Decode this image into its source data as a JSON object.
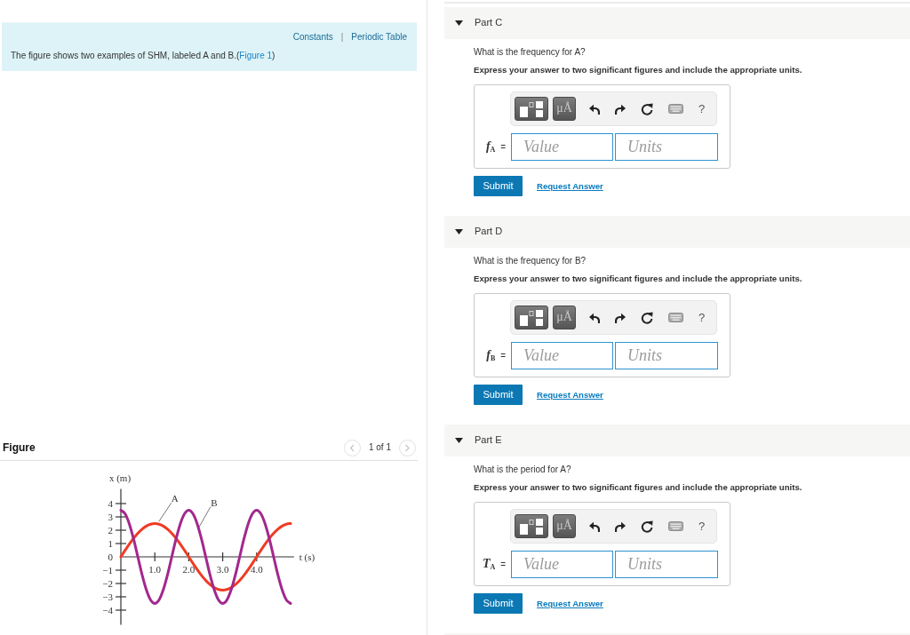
{
  "info": {
    "links": [
      "Constants",
      "Periodic Table"
    ],
    "separator": "|",
    "text": "The figure shows two examples of SHM, labeled A and B.(",
    "link": "Figure 1",
    "text_end": ")"
  },
  "figure": {
    "title": "Figure",
    "pager": {
      "prev_disabled": true,
      "label": "1 of 1",
      "next_disabled": true
    },
    "chart_data": {
      "type": "line",
      "xlabel": "t (s)",
      "ylabel": "x (m)",
      "x": [
        0,
        0.125,
        0.25,
        0.375,
        0.5,
        0.625,
        0.75,
        0.875,
        1,
        1.125,
        1.25,
        1.375,
        1.5,
        1.625,
        1.75,
        1.875,
        2,
        2.125,
        2.25,
        2.375,
        2.5,
        2.625,
        2.75,
        2.875,
        3,
        3.125,
        3.25,
        3.375,
        3.5,
        3.625,
        3.75,
        3.875,
        4,
        4.125,
        4.25,
        4.375,
        4.5,
        4.625,
        4.75,
        4.875,
        5
      ],
      "series": [
        {
          "name": "A",
          "color": "#ef3b24",
          "values": [
            0,
            0.49,
            0.96,
            1.39,
            1.77,
            2.08,
            2.31,
            2.45,
            2.5,
            2.45,
            2.31,
            2.08,
            1.77,
            1.39,
            0.96,
            0.49,
            0,
            -0.49,
            -0.96,
            -1.39,
            -1.77,
            -2.08,
            -2.31,
            -2.45,
            -2.5,
            -2.45,
            -2.31,
            -2.08,
            -1.77,
            -1.39,
            -0.96,
            -0.49,
            0,
            0.49,
            0.96,
            1.39,
            1.77,
            2.08,
            2.31,
            2.45,
            2.5
          ]
        },
        {
          "name": "B",
          "color": "#a2288e",
          "values": [
            3.5,
            3.23,
            2.47,
            1.34,
            0,
            -1.34,
            -2.47,
            -3.23,
            -3.5,
            -3.23,
            -2.47,
            -1.34,
            0,
            1.34,
            2.47,
            3.23,
            3.5,
            3.23,
            2.47,
            1.34,
            0,
            -1.34,
            -2.47,
            -3.23,
            -3.5,
            -3.23,
            -2.47,
            -1.34,
            0,
            1.34,
            2.47,
            3.23,
            3.5,
            3.23,
            2.47,
            1.34,
            0,
            -1.34,
            -2.47,
            -3.23,
            -3.5
          ]
        }
      ],
      "xlim": [
        0,
        5.1
      ],
      "ylim": [
        -5.1,
        5.1
      ],
      "xticks": [
        {
          "value": 1,
          "label": "1.0"
        },
        {
          "value": 2,
          "label": "2.0"
        },
        {
          "value": 3,
          "label": "3.0"
        },
        {
          "value": 4,
          "label": "4.0"
        }
      ],
      "yticks": [
        {
          "value": -4,
          "label": "−4"
        },
        {
          "value": -3,
          "label": "−3"
        },
        {
          "value": -2,
          "label": "−2"
        },
        {
          "value": -1,
          "label": "−1"
        },
        {
          "value": 0,
          "label": "0"
        },
        {
          "value": 1,
          "label": "1"
        },
        {
          "value": 2,
          "label": "2"
        },
        {
          "value": 3,
          "label": "3"
        },
        {
          "value": 4,
          "label": "4"
        }
      ]
    }
  },
  "parts": [
    {
      "title": "Part C",
      "expanded": true,
      "question": "What is the frequency for A?",
      "instruction": "Express your answer to two significant figures and include the appropriate units.",
      "toolbar": {
        "units_button": "μÅ",
        "help": "?"
      },
      "answer_label": "*f*$_{A}$ =",
      "value_placeholder": "Value",
      "units_placeholder": "Units",
      "submit": "Submit",
      "request_answer": "Request Answer"
    },
    {
      "title": "Part D",
      "expanded": true,
      "question": "What is the frequency for B?",
      "instruction": "Express your answer to two significant figures and include the appropriate units.",
      "toolbar": {
        "units_button": "μÅ",
        "help": "?"
      },
      "answer_label": "*f*$_{B}$ =",
      "value_placeholder": "Value",
      "units_placeholder": "Units",
      "submit": "Submit",
      "request_answer": "Request Answer"
    },
    {
      "title": "Part E",
      "expanded": true,
      "question": "What is the period for A?",
      "instruction": "Express your answer to two significant figures and include the appropriate units.",
      "toolbar": {
        "units_button": "μÅ",
        "help": "?"
      },
      "answer_label": "*T*$_{A}$ =",
      "value_placeholder": "Value",
      "units_placeholder": "Units",
      "submit": "Submit",
      "request_answer": "Request Answer"
    }
  ]
}
